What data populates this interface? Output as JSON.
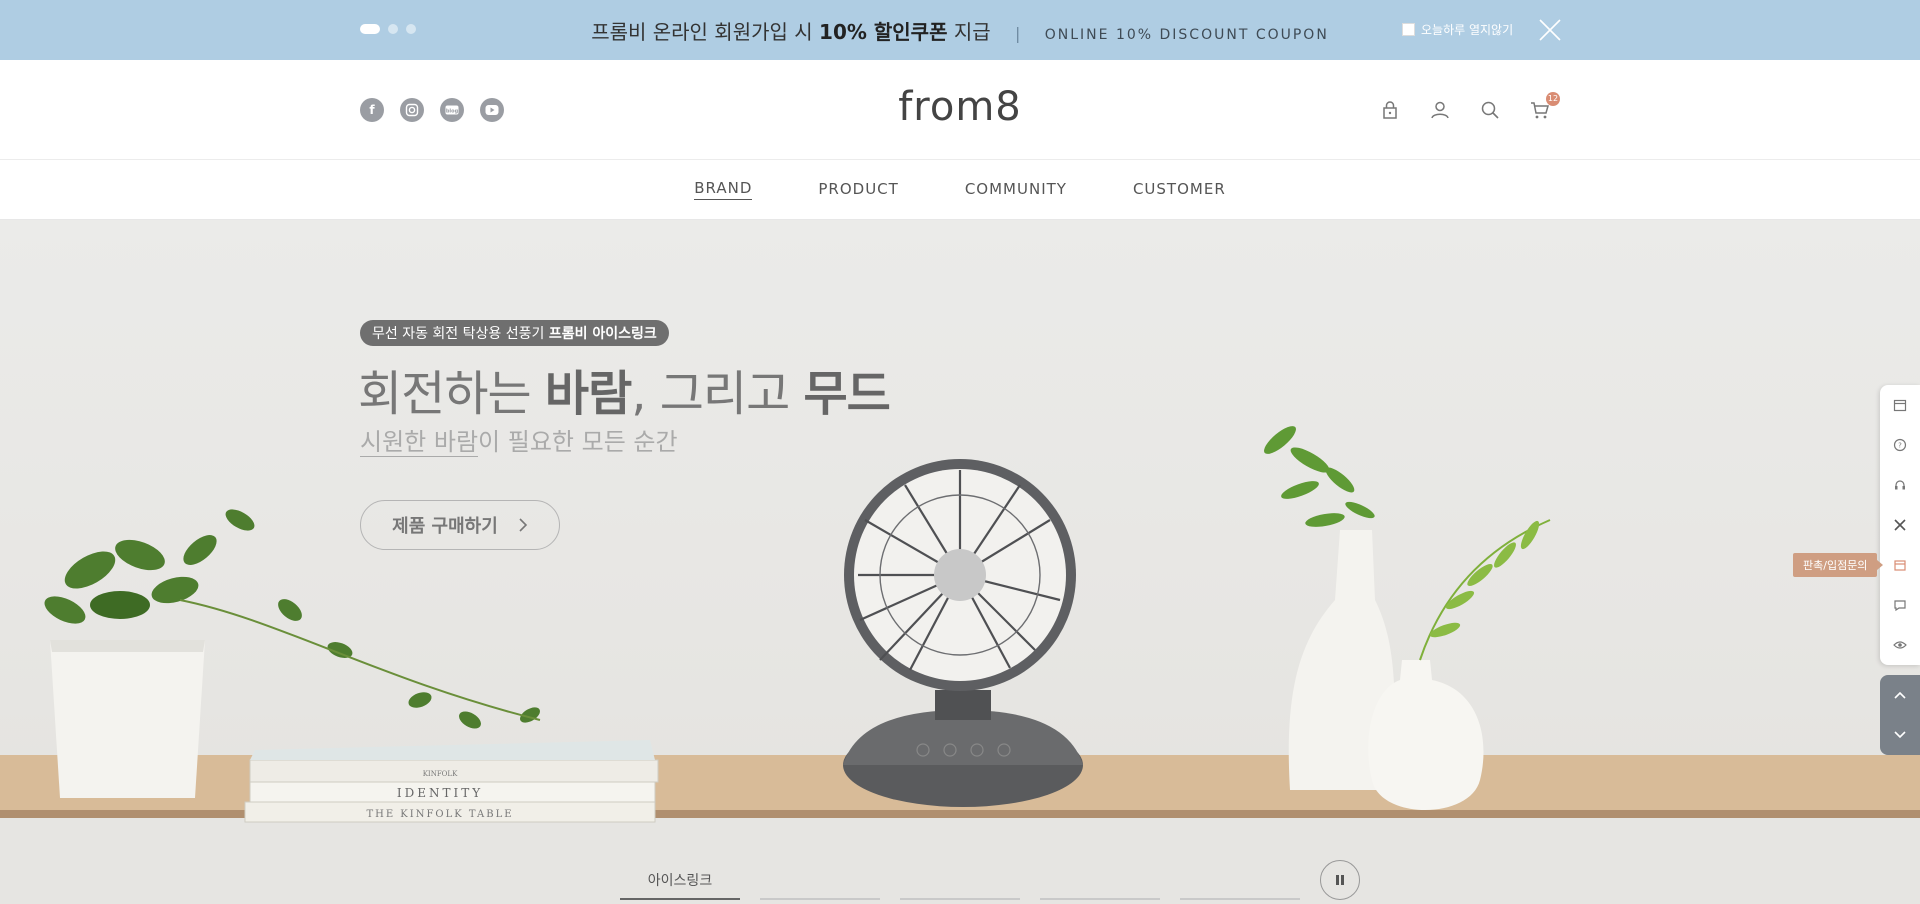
{
  "topbar": {
    "promo_prefix": "프롬비 온라인 회원가입 시 ",
    "promo_bold": "10% 할인쿠폰",
    "promo_suffix": " 지급",
    "separator": "|",
    "promo_en": "ONLINE 10% DISCOUNT COUPON",
    "no_show_label": "오늘하루 열지않기",
    "background": "#afcde3"
  },
  "header": {
    "logo": "from8",
    "social_icons": [
      "facebook-icon",
      "instagram-icon",
      "blog-icon",
      "youtube-icon"
    ],
    "util_icons": [
      "lock-icon",
      "user-icon",
      "search-icon",
      "cart-icon"
    ],
    "cart_count": "12"
  },
  "nav": {
    "items": [
      "BRAND",
      "PRODUCT",
      "COMMUNITY",
      "CUSTOMER"
    ],
    "active": "BRAND"
  },
  "hero": {
    "pill_prefix": "무선 자동 회전 탁상용 선풍기 ",
    "pill_bold": "프롬비 아이스링크",
    "headline_1": "회전하는 ",
    "headline_bold_1": "바람",
    "headline_2": ", 그리고 ",
    "headline_bold_2": "무드",
    "sub_underlined": "시원한 바람",
    "sub_rest": "이 필요한 모든 순간",
    "button_label": "제품 구매하기",
    "book_titles": [
      "KINFOLK",
      "IDENTITY",
      "THE KINFOLK TABLE"
    ]
  },
  "quick_menu": {
    "icons": [
      "calendar-icon",
      "help-icon",
      "headset-icon",
      "tools-icon",
      "store-icon",
      "chat-icon",
      "eye-icon"
    ],
    "tooltip": "판촉/입점문의",
    "scroll_icons": [
      "chevron-up-icon",
      "chevron-down-icon"
    ]
  },
  "slider_tabs": {
    "items": [
      "아이스링크",
      "",
      "",
      "",
      ""
    ],
    "active_index": 0
  },
  "colors": {
    "accent": "#d98c73",
    "tooltip": "#cf9e82"
  }
}
